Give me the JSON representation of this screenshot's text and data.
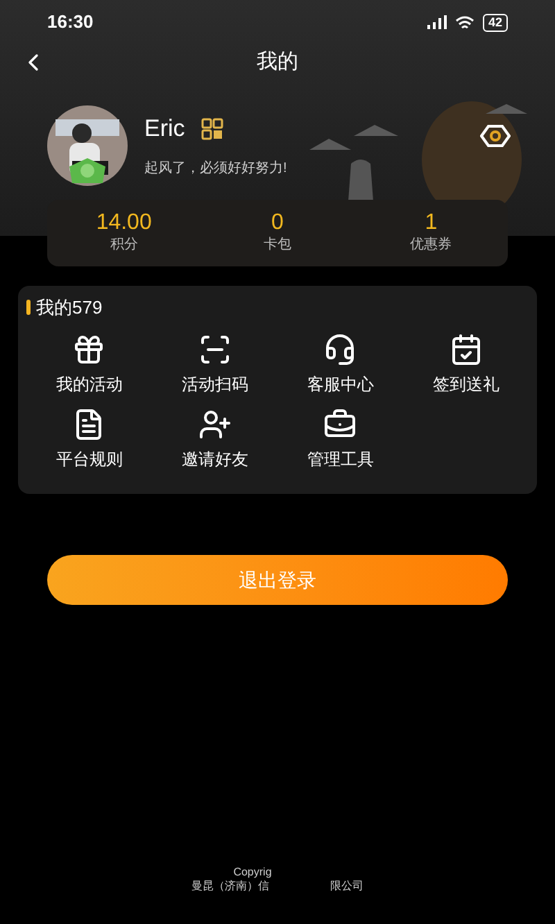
{
  "status_bar": {
    "time": "16:30",
    "battery": "42"
  },
  "nav": {
    "title": "我的"
  },
  "profile": {
    "name": "Eric",
    "motto": "起风了，必须好好努力!"
  },
  "stats": [
    {
      "value": "14.00",
      "label": "积分"
    },
    {
      "value": "0",
      "label": "卡包"
    },
    {
      "value": "1",
      "label": "优惠券"
    }
  ],
  "menu": {
    "title": "我的579",
    "items": [
      {
        "kind": "gift",
        "label": "我的活动"
      },
      {
        "kind": "scan",
        "label": "活动扫码"
      },
      {
        "kind": "headset",
        "label": "客服中心"
      },
      {
        "kind": "calendar",
        "label": "签到送礼"
      },
      {
        "kind": "document",
        "label": "平台规则"
      },
      {
        "kind": "invite",
        "label": "邀请好友"
      },
      {
        "kind": "toolbox",
        "label": "管理工具"
      }
    ]
  },
  "logout_button": "退出登录",
  "footer": {
    "line_1": "Copyrig",
    "line_2_parts": [
      "曼昆（济南）信",
      "限公司"
    ]
  }
}
